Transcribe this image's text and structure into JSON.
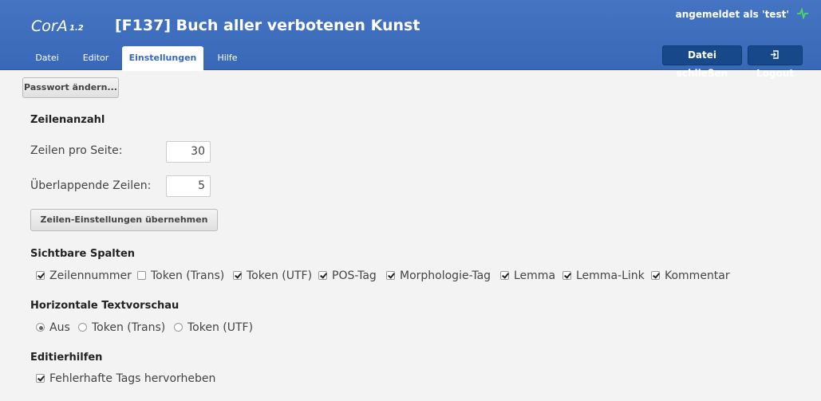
{
  "header": {
    "app_name": "CorA",
    "app_version": "1.2",
    "doc_title": "[F137] Buch aller verbotenen Kunst",
    "user_status": "angemeldet als 'test'",
    "tabs": [
      {
        "label": "Datei",
        "active": false
      },
      {
        "label": "Editor",
        "active": false
      },
      {
        "label": "Einstellungen",
        "active": true
      },
      {
        "label": "Hilfe",
        "active": false
      }
    ],
    "close_file_label": "Datei schließen",
    "logout_label": "Logout",
    "status_icon": "pulse-icon",
    "accent_color": "#3a68b8",
    "status_color": "#4cd964"
  },
  "main": {
    "change_password_label": "Passwort ändern...",
    "lines": {
      "title": "Zeilenanzahl",
      "per_page_label": "Zeilen pro Seite:",
      "per_page_value": "30",
      "overlap_label": "Überlappende Zeilen:",
      "overlap_value": "5",
      "apply_label": "Zeilen-Einstellungen übernehmen"
    },
    "columns": {
      "title": "Sichtbare Spalten",
      "items": [
        {
          "label": "Zeilennummer",
          "checked": true
        },
        {
          "label": "Token (Trans)",
          "checked": false
        },
        {
          "label": "Token (UTF)",
          "checked": true
        },
        {
          "label": "POS-Tag",
          "checked": true
        },
        {
          "label": "Morphologie-Tag",
          "checked": true
        },
        {
          "label": "Lemma",
          "checked": true
        },
        {
          "label": "Lemma-Link",
          "checked": true
        },
        {
          "label": "Kommentar",
          "checked": true
        }
      ]
    },
    "preview": {
      "title": "Horizontale Textvorschau",
      "options": [
        {
          "label": "Aus",
          "selected": true
        },
        {
          "label": "Token (Trans)",
          "selected": false
        },
        {
          "label": "Token (UTF)",
          "selected": false
        }
      ]
    },
    "helpers": {
      "title": "Editierhilfen",
      "items": [
        {
          "label": "Fehlerhafte Tags hervorheben",
          "checked": true
        }
      ]
    }
  }
}
